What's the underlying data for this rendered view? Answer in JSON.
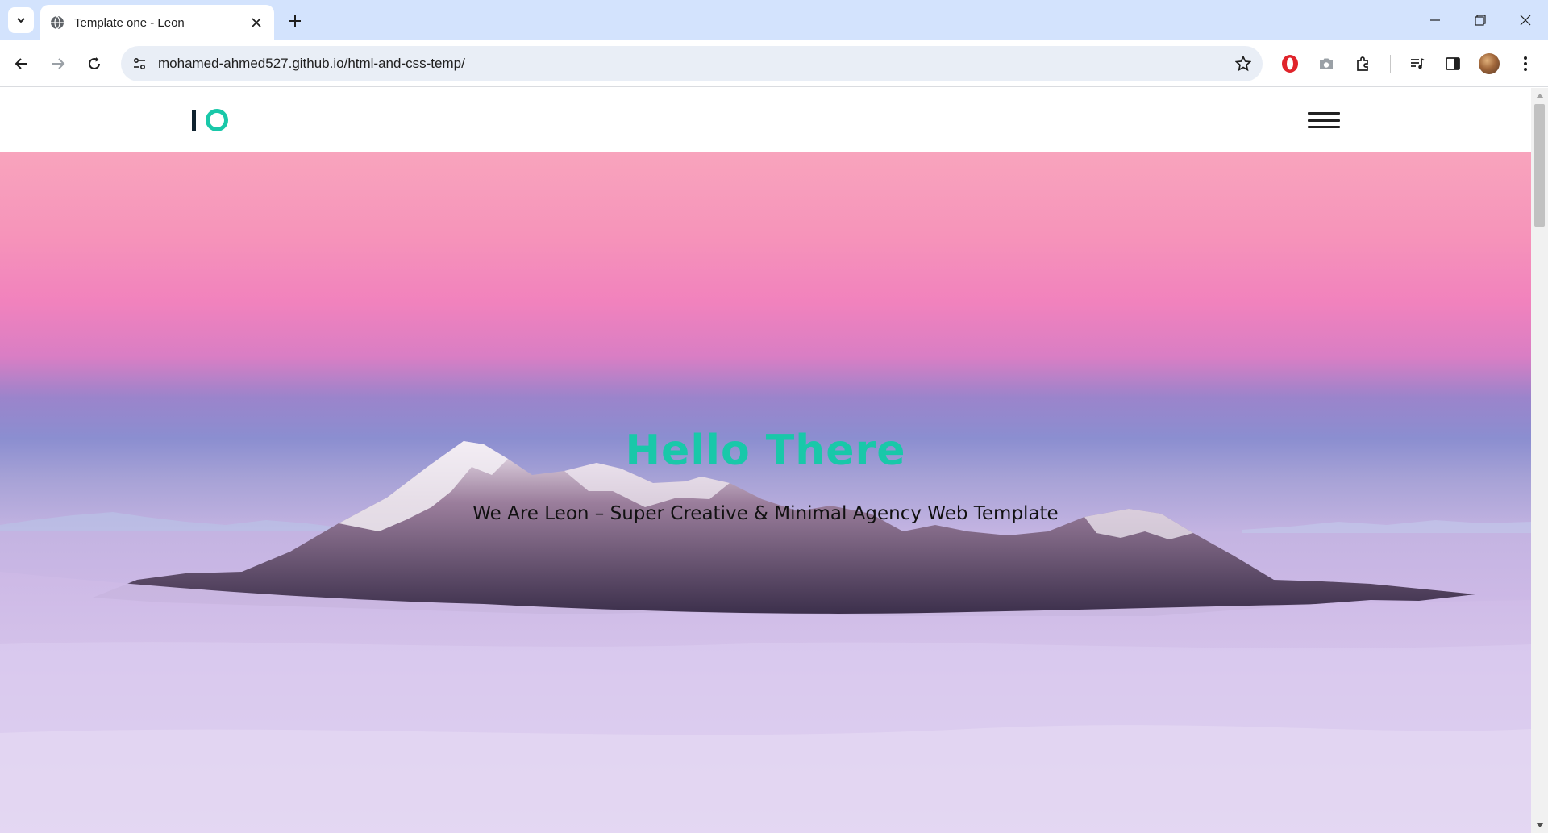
{
  "browser": {
    "tab": {
      "title": "Template one - Leon"
    },
    "address_bar": {
      "url": "mohamed-ahmed527.github.io/html-and-css-temp/"
    },
    "icons": [
      "tab-search-icon",
      "globe-icon",
      "close-icon",
      "plus-icon",
      "minimize-icon",
      "restore-icon",
      "window-close-icon",
      "back-icon",
      "forward-icon",
      "reload-icon",
      "site-info-icon",
      "star-icon",
      "opera-icon",
      "camera-icon",
      "extensions-icon",
      "media-icon",
      "side-panel-icon",
      "profile-avatar",
      "more-icon"
    ]
  },
  "site": {
    "header": {
      "logo": "IO",
      "menu_icon": "hamburger-icon"
    },
    "hero": {
      "title": "Hello There",
      "subtitle": "We Are Leon – Super Creative & Minimal Agency Web Template"
    }
  },
  "colors": {
    "accent": "#19c8a9",
    "logo_dark": "#10232f",
    "tabstrip_bg": "#d3e3fd",
    "omnibox_bg": "#e9eef6"
  }
}
